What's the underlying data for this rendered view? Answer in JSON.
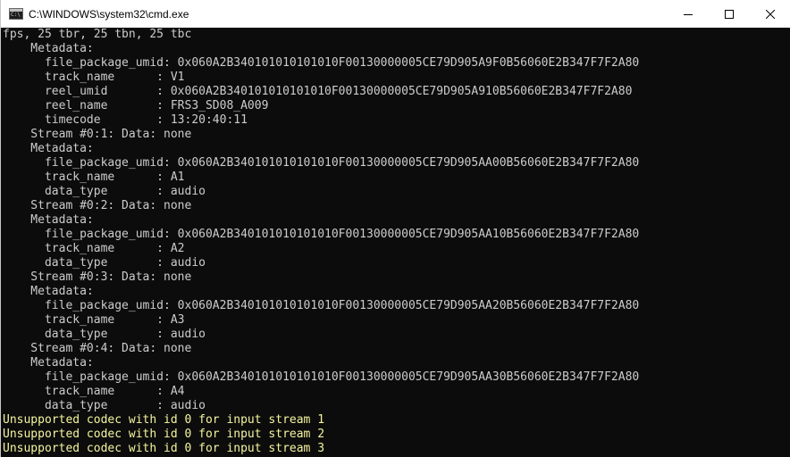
{
  "window": {
    "title": "C:\\WINDOWS\\system32\\cmd.exe",
    "icon": "cmd-console-icon",
    "controls": [
      "minimize-icon",
      "maximize-icon",
      "close-icon"
    ]
  },
  "console": {
    "text_color": "#cccccc",
    "warning_color": "#f5f5a0",
    "background": "#0c0c0c",
    "lines": [
      {
        "text": "fps, 25 tbr, 25 tbn, 25 tbc",
        "type": "normal"
      },
      {
        "text": "    Metadata:",
        "type": "normal"
      },
      {
        "text": "      file_package_umid: 0x060A2B340101010101010F00130000005CE79D905A9F0B56060E2B347F7F2A80",
        "type": "normal"
      },
      {
        "text": "      track_name      : V1",
        "type": "normal"
      },
      {
        "text": "      reel_umid       : 0x060A2B340101010101010F00130000005CE79D905A910B56060E2B347F7F2A80",
        "type": "normal"
      },
      {
        "text": "      reel_name       : FRS3_SD08_A009",
        "type": "normal"
      },
      {
        "text": "      timecode        : 13:20:40:11",
        "type": "normal"
      },
      {
        "text": "    Stream #0:1: Data: none",
        "type": "normal"
      },
      {
        "text": "    Metadata:",
        "type": "normal"
      },
      {
        "text": "      file_package_umid: 0x060A2B340101010101010F00130000005CE79D905AA00B56060E2B347F7F2A80",
        "type": "normal"
      },
      {
        "text": "      track_name      : A1",
        "type": "normal"
      },
      {
        "text": "      data_type       : audio",
        "type": "normal"
      },
      {
        "text": "    Stream #0:2: Data: none",
        "type": "normal"
      },
      {
        "text": "    Metadata:",
        "type": "normal"
      },
      {
        "text": "      file_package_umid: 0x060A2B340101010101010F00130000005CE79D905AA10B56060E2B347F7F2A80",
        "type": "normal"
      },
      {
        "text": "      track_name      : A2",
        "type": "normal"
      },
      {
        "text": "      data_type       : audio",
        "type": "normal"
      },
      {
        "text": "    Stream #0:3: Data: none",
        "type": "normal"
      },
      {
        "text": "    Metadata:",
        "type": "normal"
      },
      {
        "text": "      file_package_umid: 0x060A2B340101010101010F00130000005CE79D905AA20B56060E2B347F7F2A80",
        "type": "normal"
      },
      {
        "text": "      track_name      : A3",
        "type": "normal"
      },
      {
        "text": "      data_type       : audio",
        "type": "normal"
      },
      {
        "text": "    Stream #0:4: Data: none",
        "type": "normal"
      },
      {
        "text": "    Metadata:",
        "type": "normal"
      },
      {
        "text": "      file_package_umid: 0x060A2B340101010101010F00130000005CE79D905AA30B56060E2B347F7F2A80",
        "type": "normal"
      },
      {
        "text": "      track_name      : A4",
        "type": "normal"
      },
      {
        "text": "      data_type       : audio",
        "type": "normal"
      },
      {
        "text": "Unsupported codec with id 0 for input stream 1",
        "type": "warn"
      },
      {
        "text": "Unsupported codec with id 0 for input stream 2",
        "type": "warn"
      },
      {
        "text": "Unsupported codec with id 0 for input stream 3",
        "type": "warn"
      }
    ]
  }
}
